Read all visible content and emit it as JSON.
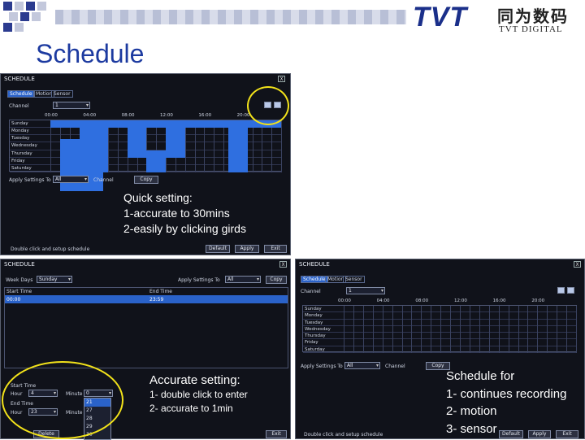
{
  "header": {
    "brand_main": "TVT",
    "brand_cn": "同为数码",
    "brand_sub": "TVT DIGITAL"
  },
  "page_title": "Schedule",
  "window1": {
    "title": "SCHEDULE",
    "close": "X",
    "tabs": [
      "Schedule",
      "Motion",
      "Sensor"
    ],
    "channel_label": "Channel",
    "channel_value": "1",
    "hours": [
      "00:00",
      "04:00",
      "08:00",
      "12:00",
      "16:00",
      "20:00"
    ],
    "days": [
      "Sunday",
      "Monday",
      "Tuesday",
      "Wednesday",
      "Thursday",
      "Friday",
      "Saturday"
    ],
    "apply_label": "Apply Settings To",
    "apply_value": "All",
    "apply_channel_label": "Channel",
    "copy_btn": "Copy",
    "status_text": "Double click and setup schedule",
    "default_btn": "Default",
    "apply_btn": "Apply",
    "exit_btn": "Exit",
    "note_line1": "Quick setting:",
    "note_line2": "1-accurate to 30mins",
    "note_line3": "2-easily by clicking girds"
  },
  "window2": {
    "title": "SCHEDULE",
    "close": "X",
    "week_days_label": "Week Days",
    "week_days_value": "Sunday",
    "apply_label": "Apply Settings To",
    "apply_value": "All",
    "copy_btn": "Copy",
    "col_start": "Start Time",
    "col_end": "End Time",
    "row_start": "00:00",
    "row_end": "23:59",
    "start_time_label": "Start Time",
    "end_time_label": "End Time",
    "hour_label": "Hour",
    "minute_label": "Minute",
    "start_hour": "4",
    "start_minute": "0",
    "end_hour": "23",
    "minute_options": [
      "21",
      "27",
      "28",
      "29",
      "30"
    ],
    "delete_btn": "Delete",
    "exit_btn": "Exit",
    "note_line1": "Accurate setting:",
    "note_line2": "1- double click to enter",
    "note_line3": "2- accurate to 1min"
  },
  "window3": {
    "title": "SCHEDULE",
    "close": "X",
    "tabs": [
      "Schedule",
      "Motion",
      "Sensor"
    ],
    "channel_label": "Channel",
    "channel_value": "1",
    "hours": [
      "00:00",
      "04:00",
      "08:00",
      "12:00",
      "16:00",
      "20:00"
    ],
    "days": [
      "Sunday",
      "Monday",
      "Tuesday",
      "Wednesday",
      "Thursday",
      "Friday",
      "Saturday"
    ],
    "apply_label": "Apply Settings To",
    "apply_value": "All",
    "apply_channel_label": "Channel",
    "copy_btn": "Copy",
    "status_text": "Double click and setup schedule",
    "default_btn": "Default",
    "apply_btn": "Apply",
    "exit_btn": "Exit"
  },
  "note3": {
    "line1": "Schedule for",
    "line2": "1- continues recording",
    "line3": "2- motion",
    "line4": "3- sensor"
  },
  "colors": {
    "accent": "#1c3aa0",
    "cell_blue": "#2f6fe0",
    "highlight_oval": "#f2e21a"
  }
}
